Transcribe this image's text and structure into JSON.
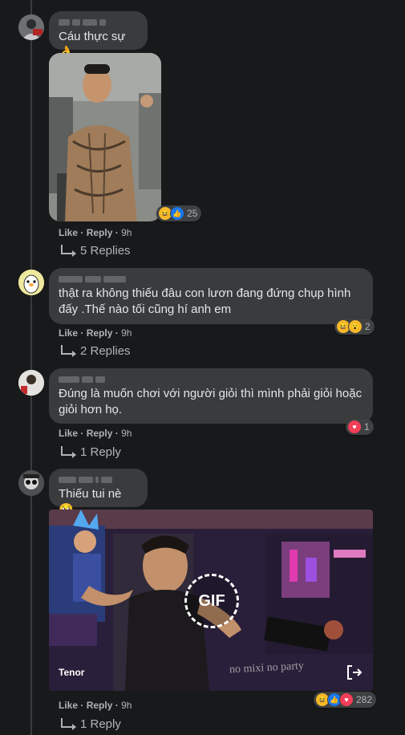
{
  "comments": [
    {
      "text": "Cáu thực sự 👌",
      "reactions": {
        "count": "25"
      },
      "actions": {
        "like": "Like",
        "reply": "Reply",
        "time": "9h",
        "sep": "·"
      },
      "replies": "5 Replies"
    },
    {
      "text": "thật ra không thiếu đâu con lươn đang đứng chụp hình đấy .Thế nào tối cũng hí anh em",
      "reactions": {
        "count": "2"
      },
      "actions": {
        "like": "Like",
        "reply": "Reply",
        "time": "9h",
        "sep": "·"
      },
      "replies": "2 Replies"
    },
    {
      "text": "Đúng là muốn chơi với người giỏi thì mình phải giỏi hoặc giỏi hơn họ.",
      "reactions": {
        "count": "1"
      },
      "actions": {
        "like": "Like",
        "reply": "Reply",
        "time": "9h",
        "sep": "·"
      },
      "replies": "1 Reply"
    },
    {
      "text": "Thiếu tui nè 🥹",
      "gif": {
        "badge": "GIF",
        "source": "Tenor",
        "overlay": "no mixi no party"
      },
      "reactions": {
        "count": "282"
      },
      "actions": {
        "like": "Like",
        "reply": "Reply",
        "time": "9h",
        "sep": "·"
      },
      "replies": "1 Reply"
    }
  ],
  "colors": {
    "background": "#18191a",
    "bubble": "#3a3b3c",
    "muted": "#b0b3b8",
    "text": "#e4e6eb",
    "like": "#1877f2",
    "love": "#f33e58",
    "haha": "#f7b928"
  },
  "icons": [
    "reply-arrow-icon",
    "haha-reaction-icon",
    "like-reaction-icon",
    "love-reaction-icon",
    "wow-reaction-icon",
    "share-icon"
  ]
}
